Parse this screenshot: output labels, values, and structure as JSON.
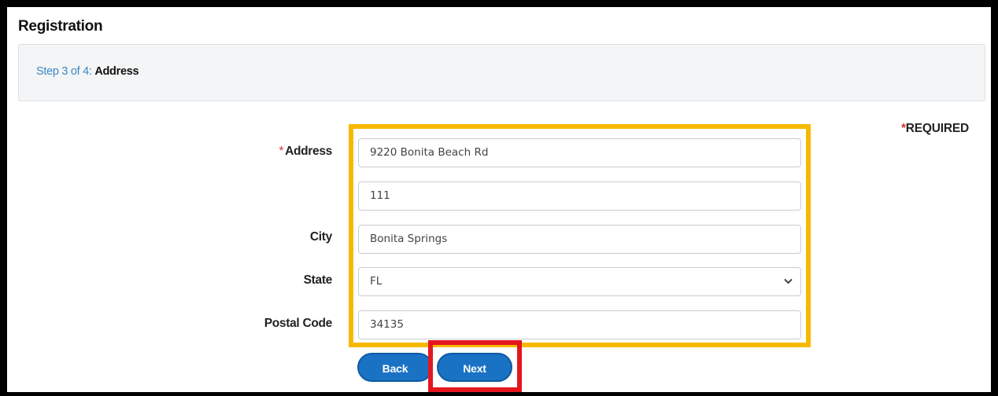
{
  "page": {
    "title": "Registration"
  },
  "step": {
    "prefix": "Step 3 of 4:",
    "name": "Address"
  },
  "required_note": {
    "star": "*",
    "text": "REQUIRED"
  },
  "form": {
    "address_label": "Address",
    "address_star": "*",
    "address_line1": "9220 Bonita Beach Rd",
    "address_line2": "111",
    "city_label": "City",
    "city_value": "Bonita Springs",
    "state_label": "State",
    "state_value": "FL",
    "postal_label": "Postal Code",
    "postal_value": "34135"
  },
  "buttons": {
    "back_label": "Back",
    "next_label": "Next"
  },
  "colors": {
    "highlight_yellow": "#f6b900",
    "highlight_red": "#e4161f",
    "button_blue": "#1a72c4",
    "step_link_blue": "#3a87c9",
    "required_red": "#d9342b"
  },
  "icons": {
    "state_dropdown": "chevron-down-icon"
  }
}
